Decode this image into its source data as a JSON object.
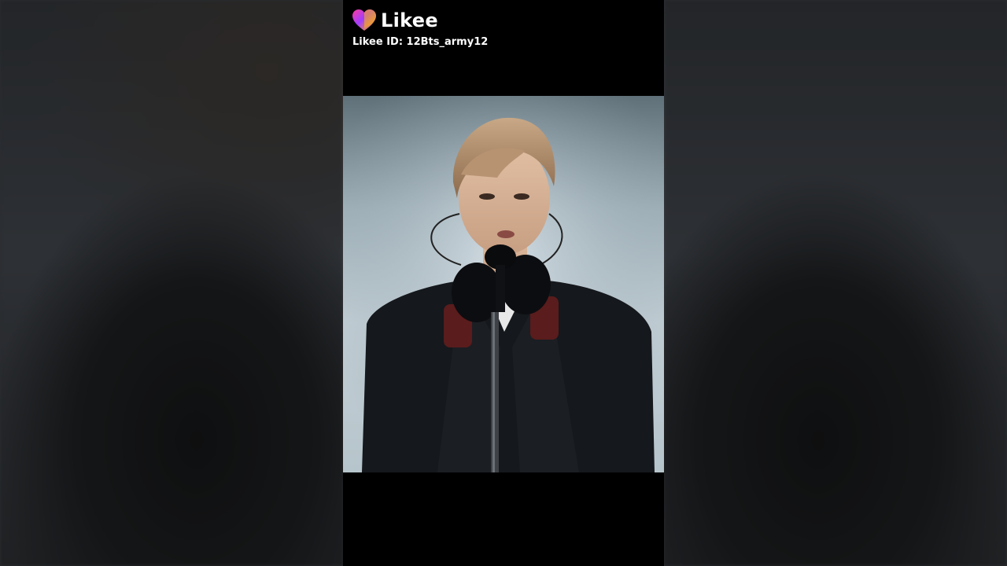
{
  "app": {
    "brand_name": "Likee",
    "user_id_text": "Likee ID: 12Bts_army12"
  },
  "icons": {
    "brand": "heart-gradient-icon"
  },
  "colors": {
    "letterbox": "#000000",
    "brand_gradient": [
      "#ff3c9a",
      "#8a3cff",
      "#ffb400"
    ]
  },
  "video": {
    "content": "performer-singing-into-microphone"
  }
}
